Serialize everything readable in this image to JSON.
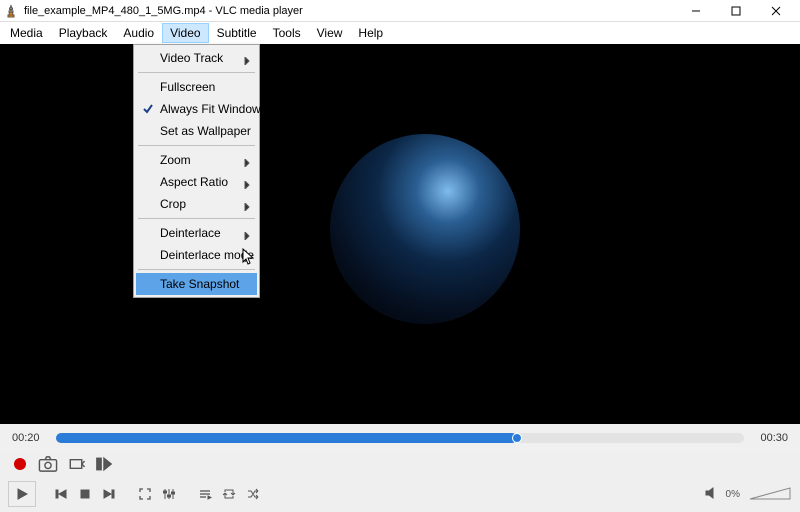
{
  "window": {
    "title": "file_example_MP4_480_1_5MG.mp4 - VLC media player"
  },
  "menubar": {
    "media": "Media",
    "playback": "Playback",
    "audio": "Audio",
    "video": "Video",
    "subtitle": "Subtitle",
    "tools": "Tools",
    "view": "View",
    "help": "Help"
  },
  "video_menu": {
    "video_track": "Video Track",
    "fullscreen": "Fullscreen",
    "always_fit_window": "Always Fit Window",
    "set_as_wallpaper": "Set as Wallpaper",
    "zoom": "Zoom",
    "aspect_ratio": "Aspect Ratio",
    "crop": "Crop",
    "deinterlace": "Deinterlace",
    "deinterlace_mode": "Deinterlace mode",
    "take_snapshot": "Take Snapshot"
  },
  "playback": {
    "current_time": "00:20",
    "total_time": "00:30"
  },
  "volume": {
    "percent": "0%"
  }
}
